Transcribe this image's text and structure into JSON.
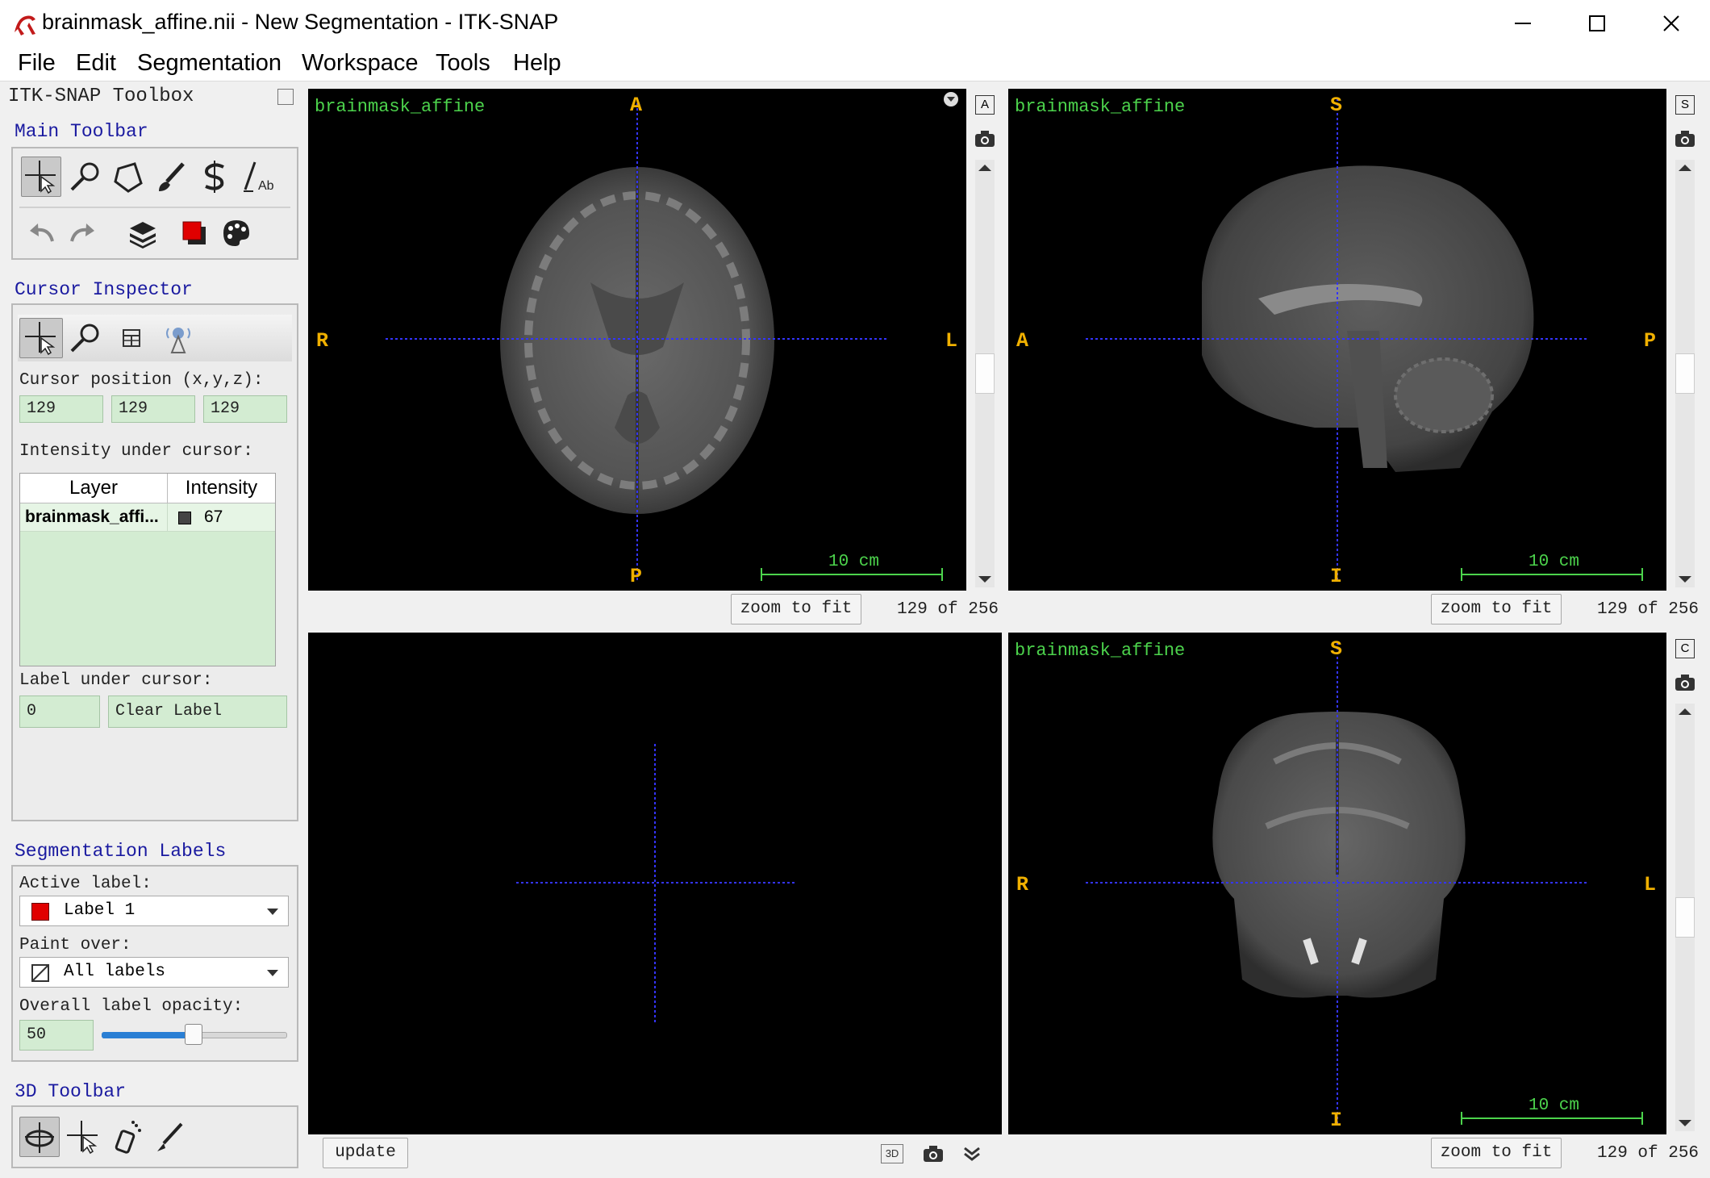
{
  "window": {
    "title": "brainmask_affine.nii - New Segmentation - ITK-SNAP"
  },
  "menu": [
    "File",
    "Edit",
    "Segmentation",
    "Workspace",
    "Tools",
    "Help"
  ],
  "toolbox": {
    "title": "ITK-SNAP Toolbox",
    "main_toolbar": {
      "heading": "Main Toolbar",
      "tools": [
        "crosshair-tool",
        "zoom-tool",
        "polygon-tool",
        "paintbrush-tool",
        "snake-tool",
        "annotation-tool"
      ],
      "actions": [
        "undo",
        "redo",
        "layers",
        "label-color",
        "color-palette"
      ]
    },
    "cursor_inspector": {
      "heading": "Cursor Inspector",
      "position_label": "Cursor position (x,y,z):",
      "x": "129",
      "y": "129",
      "z": "129",
      "intensity_label": "Intensity under cursor:",
      "table_headers": [
        "Layer",
        "Intensity"
      ],
      "rows": [
        {
          "layer": "brainmask_affi...",
          "intensity": "67"
        }
      ],
      "label_under_cursor": "Label under cursor:",
      "label_value": "0",
      "label_name": "Clear Label"
    },
    "segmentation_labels": {
      "heading": "Segmentation Labels",
      "active_label_caption": "Active label:",
      "active_label": "Label 1",
      "active_label_color": "#e00000",
      "paint_over_caption": "Paint over:",
      "paint_over": "All labels",
      "opacity_caption": "Overall label opacity:",
      "opacity_value": "50",
      "opacity_fraction": 0.5
    },
    "toolbar_3d": {
      "heading": "3D Toolbar"
    }
  },
  "views": {
    "axial": {
      "layer": "brainmask_affine",
      "top": "A",
      "bottom": "P",
      "left": "R",
      "right": "L",
      "scale": "10 cm",
      "zoom_button": "zoom to fit",
      "slice": "129 of 256",
      "corner_btn": "A"
    },
    "sagittal": {
      "layer": "brainmask_affine",
      "top": "S",
      "bottom": "I",
      "left": "A",
      "right": "P",
      "scale": "10 cm",
      "zoom_button": "zoom to fit",
      "slice": "129 of 256",
      "corner_btn": "S"
    },
    "coronal": {
      "layer": "brainmask_affine",
      "top": "S",
      "bottom": "I",
      "left": "R",
      "right": "L",
      "scale": "10 cm",
      "zoom_button": "zoom to fit",
      "slice": "129 of 256",
      "corner_btn": "C"
    },
    "render3d": {
      "update_button": "update",
      "btn_3d": "3D"
    }
  },
  "colors": {
    "label_text": "#4cd34c",
    "orientation": "#f0b000",
    "crosshair": "#3434ff",
    "field_bg": "#d3ecd2"
  }
}
